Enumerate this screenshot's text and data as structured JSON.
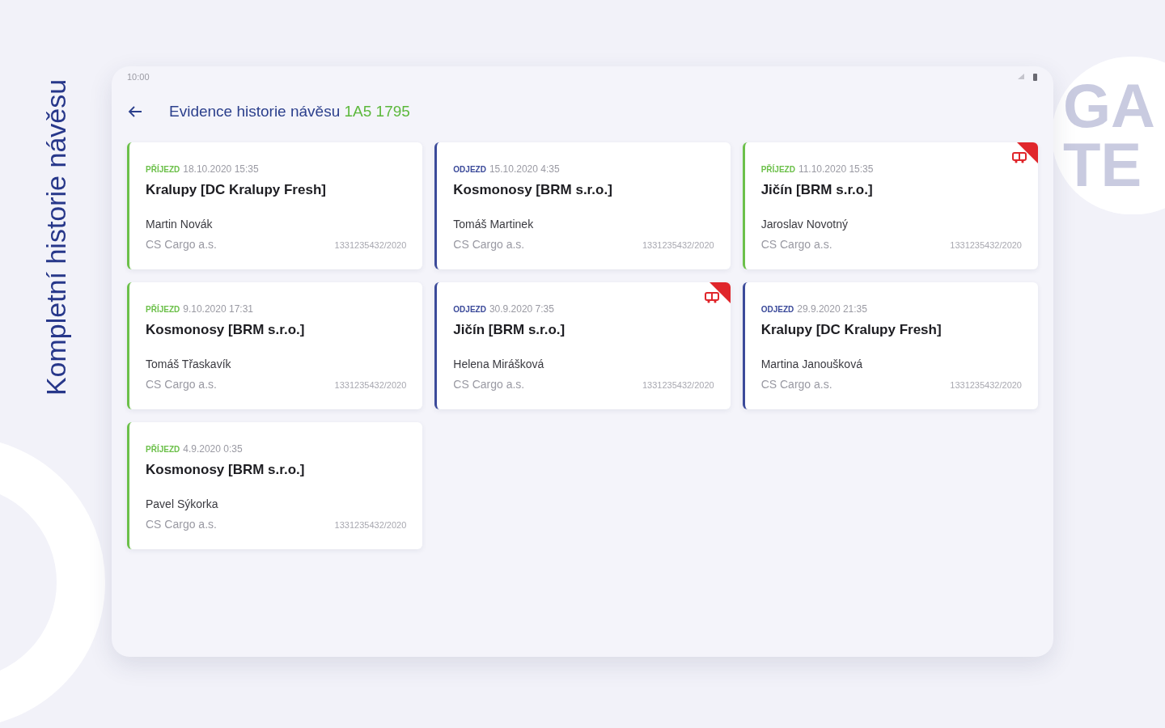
{
  "side_caption": "Kompletní historie návěsu",
  "brand_logo": {
    "lines": [
      "GA",
      "TE"
    ]
  },
  "status_bar": {
    "time": "10:00"
  },
  "header": {
    "title": "Evidence historie návěsu",
    "plate": "1A5 1795"
  },
  "records": [
    {
      "kind": "arrival",
      "label": "PŘÍJEZD",
      "datetime": "18.10.2020 15:35",
      "place": "Kralupy [DC Kralupy Fresh]",
      "driver": "Martin Novák",
      "company": "CS Cargo a.s.",
      "number": "1331235432/2020",
      "flagged": false
    },
    {
      "kind": "departure",
      "label": "ODJEZD",
      "datetime": "15.10.2020 4:35",
      "place": "Kosmonosy [BRM s.r.o.]",
      "driver": "Tomáš Martinek",
      "company": "CS Cargo a.s.",
      "number": "1331235432/2020",
      "flagged": false
    },
    {
      "kind": "arrival",
      "label": "PŘÍJEZD",
      "datetime": "11.10.2020 15:35",
      "place": "Jičín [BRM s.r.o.]",
      "driver": "Jaroslav Novotný",
      "company": "CS Cargo a.s.",
      "number": "1331235432/2020",
      "flagged": true
    },
    {
      "kind": "arrival",
      "label": "PŘÍJEZD",
      "datetime": "9.10.2020 17:31",
      "place": "Kosmonosy [BRM s.r.o.]",
      "driver": "Tomáš Třaskavík",
      "company": "CS Cargo a.s.",
      "number": "1331235432/2020",
      "flagged": false
    },
    {
      "kind": "departure",
      "label": "ODJEZD",
      "datetime": "30.9.2020 7:35",
      "place": "Jičín [BRM s.r.o.]",
      "driver": "Helena Mirášková",
      "company": "CS Cargo a.s.",
      "number": "1331235432/2020",
      "flagged": true
    },
    {
      "kind": "departure",
      "label": "ODJEZD",
      "datetime": "29.9.2020 21:35",
      "place": "Kralupy [DC Kralupy Fresh]",
      "driver": "Martina Janoušková",
      "company": "CS Cargo a.s.",
      "number": "1331235432/2020",
      "flagged": false
    },
    {
      "kind": "arrival",
      "label": "PŘÍJEZD",
      "datetime": "4.9.2020 0:35",
      "place": "Kosmonosy [BRM s.r.o.]",
      "driver": "Pavel Sýkorka",
      "company": "CS Cargo a.s.",
      "number": "1331235432/2020",
      "flagged": false
    }
  ]
}
